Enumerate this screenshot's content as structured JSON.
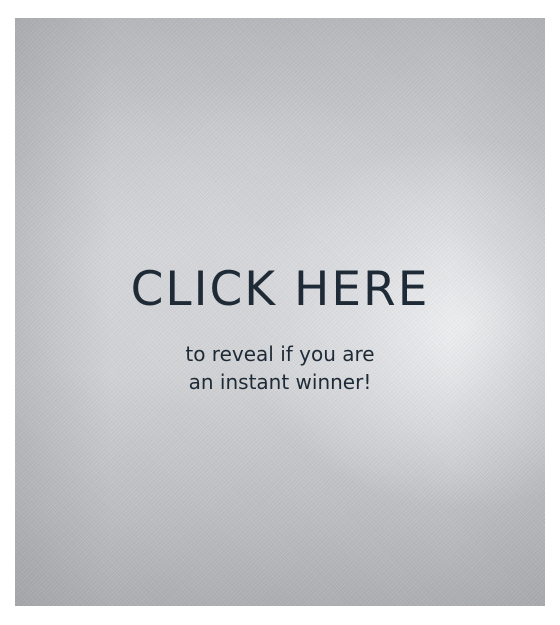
{
  "card": {
    "headline": "CLICK HERE",
    "subline_1": "to reveal if you are",
    "subline_2": "an instant winner!"
  },
  "colors": {
    "text": "#1e2a36",
    "card_silver": "#d6d7da",
    "background": "#ffffff"
  }
}
